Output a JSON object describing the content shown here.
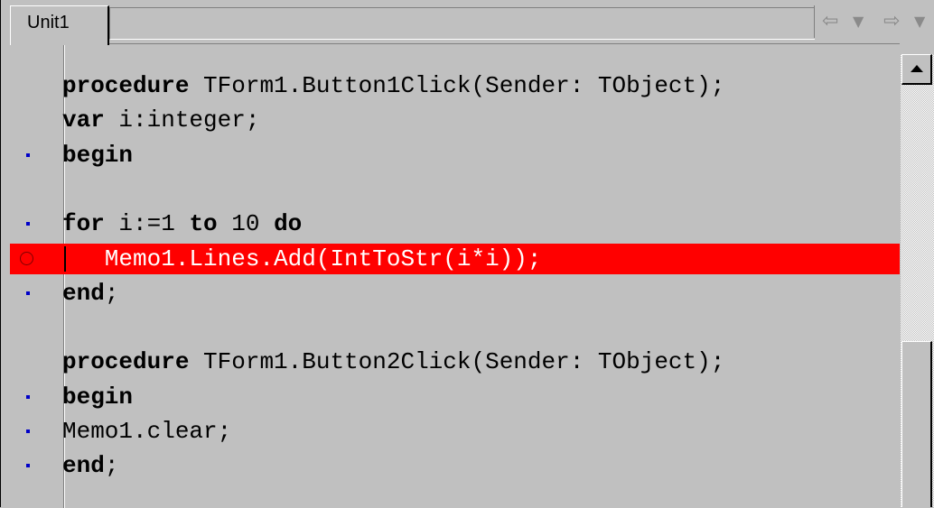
{
  "tabs": [
    {
      "label": "Unit1",
      "active": true
    }
  ],
  "nav": {
    "back_icon": "arrow-left-icon",
    "dropdown_icon": "chevron-down-icon",
    "forward_icon": "arrow-right-icon"
  },
  "colors": {
    "background": "#c0c0c0",
    "breakpoint_highlight": "#ff0000",
    "execution_dot": "#0000c8"
  },
  "code_lines": [
    {
      "keyword": "procedure",
      "rest": " TForm1.Button1Click(Sender: TObject);",
      "marker": "none"
    },
    {
      "keyword": "var",
      "rest": " i:integer;",
      "marker": "none"
    },
    {
      "keyword": "begin",
      "rest": "",
      "marker": "dot"
    },
    {
      "keyword": "",
      "rest": "",
      "marker": "none"
    },
    {
      "keyword": "for",
      "rest": " i:=1 ",
      "kw2": "to",
      "rest2": " 10 ",
      "kw3": "do",
      "marker": "dot"
    },
    {
      "keyword": "",
      "rest": "   Memo1.Lines.Add(IntToStr(i*i));",
      "marker": "breakpoint",
      "highlighted": true
    },
    {
      "keyword": "end",
      "rest": ";",
      "marker": "dot"
    },
    {
      "keyword": "",
      "rest": "",
      "marker": "none"
    },
    {
      "keyword": "procedure",
      "rest": " TForm1.Button2Click(Sender: TObject);",
      "marker": "none"
    },
    {
      "keyword": "begin",
      "rest": "",
      "marker": "dot"
    },
    {
      "keyword": "",
      "rest": "Memo1.clear;",
      "marker": "dot"
    },
    {
      "keyword": "end",
      "rest": ";",
      "marker": "dot"
    }
  ]
}
